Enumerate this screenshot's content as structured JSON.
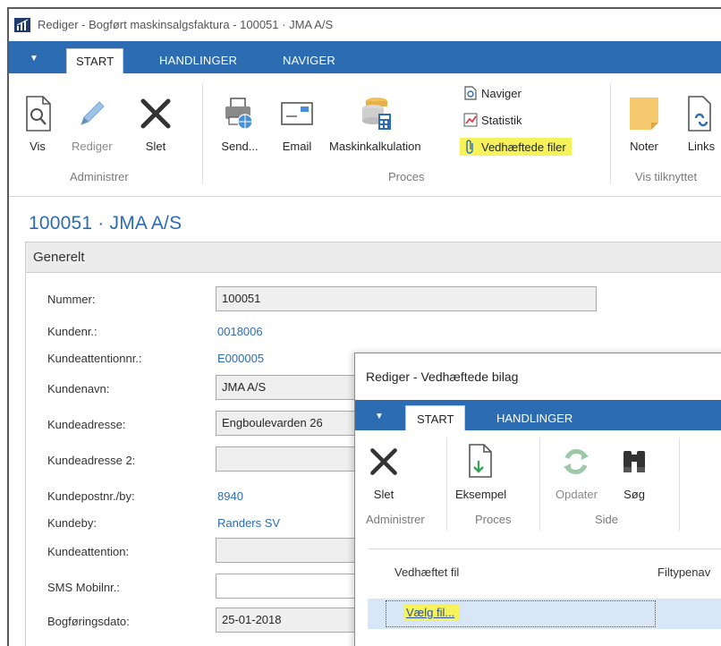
{
  "window": {
    "title": "Rediger - Bogført maskinsalgsfaktura - 100051 · JMA A/S"
  },
  "tabs": {
    "start": "START",
    "handlinger": "HANDLINGER",
    "naviger": "NAVIGER"
  },
  "ribbon": {
    "vis": "Vis",
    "rediger": "Rediger",
    "slet": "Slet",
    "send": "Send...",
    "email": "Email",
    "maskinkalkulation": "Maskinkalkulation",
    "naviger": "Naviger",
    "statistik": "Statistik",
    "vedhaeftede_filer": "Vedhæftede filer",
    "noter": "Noter",
    "links": "Links",
    "groups": {
      "administrer": "Administrer",
      "proces": "Proces",
      "vis_tilknyttet": "Vis tilknyttet"
    },
    "highlight_color": "#f6f25a"
  },
  "page": {
    "title": "100051 · JMA A/S",
    "fasttab": "Generelt"
  },
  "fields": {
    "nummer": {
      "label": "Nummer:",
      "value": "100051"
    },
    "kundenr": {
      "label": "Kundenr.:",
      "value": "0018006"
    },
    "kundeattentionnr": {
      "label": "Kundeattentionnr.:",
      "value": "E000005"
    },
    "kundenavn": {
      "label": "Kundenavn:",
      "value": "JMA A/S"
    },
    "kundeadresse": {
      "label": "Kundeadresse:",
      "value": "Engboulevarden 26"
    },
    "kundeadresse2": {
      "label": "Kundeadresse 2:",
      "value": ""
    },
    "kundepostnr": {
      "label": "Kundepostnr./by:",
      "value": "8940"
    },
    "kundeby": {
      "label": "Kundeby:",
      "value": "Randers SV"
    },
    "kundeattention": {
      "label": "Kundeattention:",
      "value": ""
    },
    "sms": {
      "label": "SMS Mobilnr.:",
      "value": ""
    },
    "bogforingsdato": {
      "label": "Bogføringsdato:",
      "value": "25-01-2018"
    }
  },
  "dialog": {
    "title": "Rediger - Vedhæftede bilag",
    "tabs": {
      "start": "START",
      "handlinger": "HANDLINGER"
    },
    "buttons": {
      "slet": "Slet",
      "eksempel": "Eksempel",
      "opdater": "Opdater",
      "sog": "Søg"
    },
    "groups": {
      "administrer": "Administrer",
      "proces": "Proces",
      "side": "Side"
    },
    "columns": {
      "vedhaeftet_fil": "Vedhæftet fil",
      "filtypenavn": "Filtypenav"
    },
    "row": {
      "link": "Vælg fil..."
    }
  },
  "colors": {
    "accent": "#2b6cb3",
    "highlight": "#f6f25a",
    "selected_row": "#d7e7f7"
  }
}
